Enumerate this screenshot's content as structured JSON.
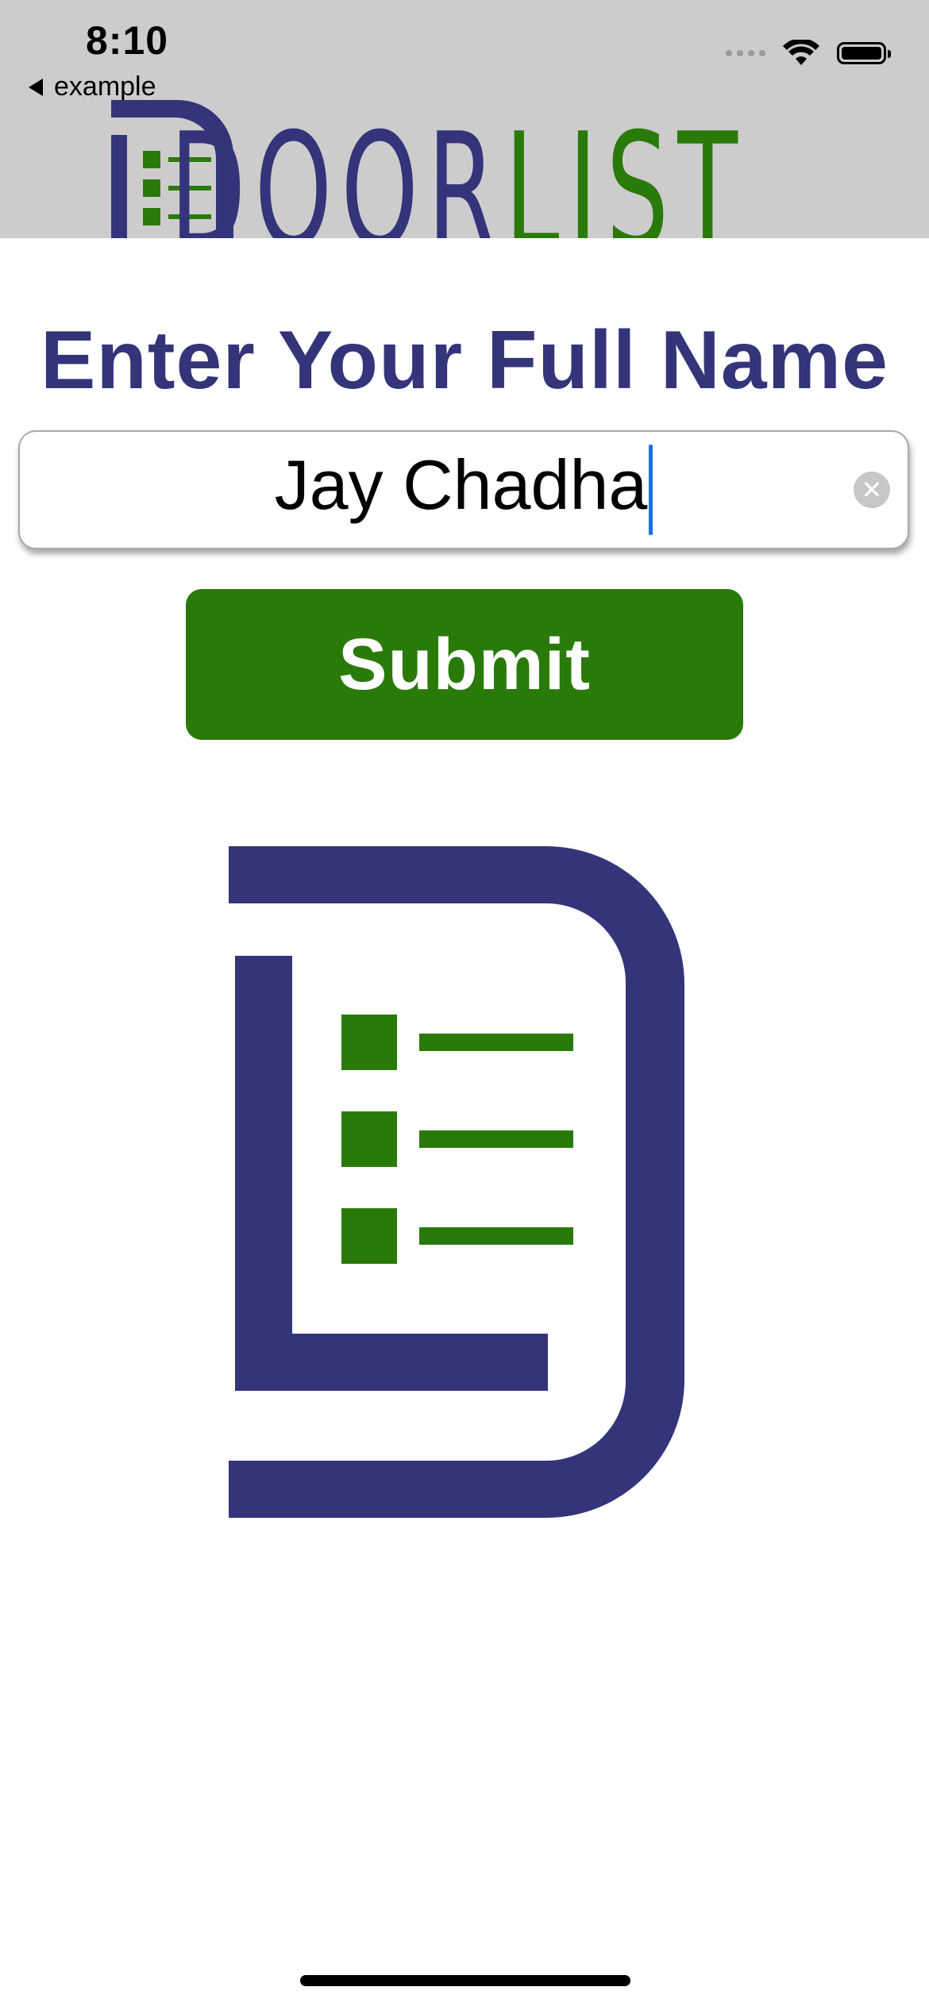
{
  "status_bar": {
    "time": "8:10",
    "back_label": "example",
    "icons": [
      "cellular-dots-icon",
      "wifi-icon",
      "battery-icon"
    ]
  },
  "banner": {
    "brand_part1": "DOOR",
    "brand_part2": "LIST"
  },
  "form": {
    "title": "Enter Your Full Name",
    "name_value": "Jay Chadha",
    "clear_glyph": "✕",
    "submit_label": "Submit"
  },
  "colors": {
    "brand_navy": "#34347a",
    "brand_green": "#2a7a0a",
    "header_gray": "#cccccc",
    "caret_blue": "#1a73e8"
  }
}
